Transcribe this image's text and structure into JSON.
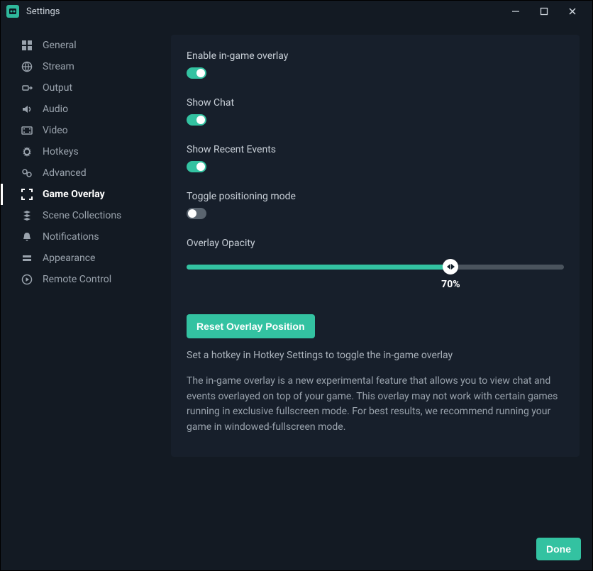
{
  "window": {
    "title": "Settings"
  },
  "sidebar": {
    "items": [
      {
        "label": "General"
      },
      {
        "label": "Stream"
      },
      {
        "label": "Output"
      },
      {
        "label": "Audio"
      },
      {
        "label": "Video"
      },
      {
        "label": "Hotkeys"
      },
      {
        "label": "Advanced"
      },
      {
        "label": "Game Overlay"
      },
      {
        "label": "Scene Collections"
      },
      {
        "label": "Notifications"
      },
      {
        "label": "Appearance"
      },
      {
        "label": "Remote Control"
      }
    ],
    "activeIndex": 7
  },
  "settings": {
    "enableOverlay": {
      "label": "Enable in-game overlay",
      "value": true
    },
    "showChat": {
      "label": "Show Chat",
      "value": true
    },
    "showRecent": {
      "label": "Show Recent Events",
      "value": true
    },
    "togglePositioning": {
      "label": "Toggle positioning mode",
      "value": false
    },
    "opacity": {
      "label": "Overlay Opacity",
      "value": 70,
      "display": "70%"
    },
    "resetButton": "Reset Overlay Position",
    "hint1": "Set a hotkey in Hotkey Settings to toggle the in-game overlay",
    "hint2": "The in-game overlay is a new experimental feature that allows you to view chat and events overlayed on top of your game. This overlay may not work with certain games running in exclusive fullscreen mode. For best results, we recommend running your game in windowed-fullscreen mode."
  },
  "footer": {
    "done": "Done"
  }
}
